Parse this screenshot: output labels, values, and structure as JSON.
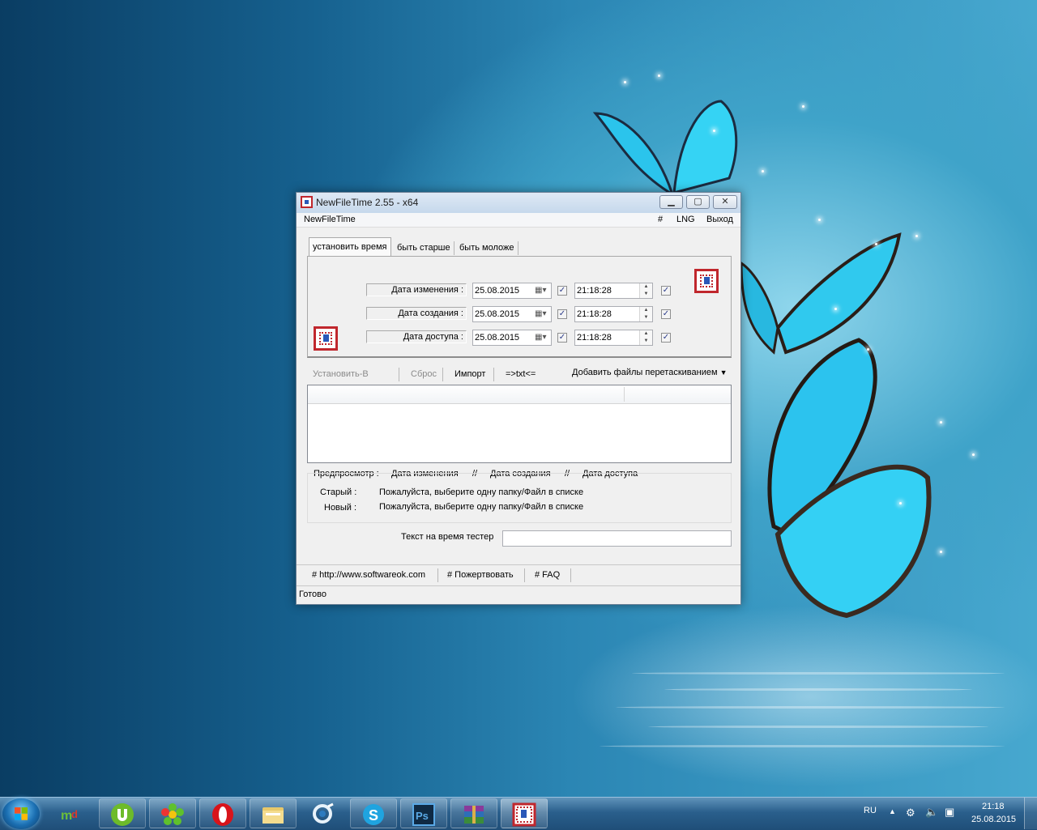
{
  "window": {
    "title": "NewFileTime 2.55 - x64",
    "minimize": "▁",
    "maximize": "▢",
    "close": "✕"
  },
  "menu": {
    "app": "NewFileTime",
    "hash": "#",
    "lng": "LNG",
    "exit": "Выход"
  },
  "tabs": [
    "установить время",
    "быть старше",
    "быть моложе"
  ],
  "rows": [
    {
      "label": "Дата изменения :",
      "date": "25.08.2015",
      "time": "21:18:28",
      "checked": true
    },
    {
      "label": "Дата создания :",
      "date": "25.08.2015",
      "time": "21:18:28",
      "checked": true
    },
    {
      "label": "Дата доступа :",
      "date": "25.08.2015",
      "time": "21:18:28",
      "checked": true
    }
  ],
  "toolbar": {
    "set": "Установить-В",
    "reset": "Сброс",
    "import": "Импорт",
    "txt": "=>txt<=",
    "dragdrop": "Добавить файлы перетаскиванием"
  },
  "preview": {
    "label": "Предпросмотр  :",
    "col1": "Дата изменения",
    "sep": "//",
    "col2": "Дата создания",
    "col3": "Дата доступа",
    "old_label": "Старый :",
    "old_value": "Пожалуйста, выберите одну папку/Файл в списке",
    "new_label": "Новый :",
    "new_value": "Пожалуйста, выберите одну папку/Файл в списке"
  },
  "tester": {
    "label": "Текст на время тестер",
    "value": ""
  },
  "links": {
    "website": "# http://www.softwareok.com",
    "donate": "# Пожертвовать",
    "faq": "# FAQ"
  },
  "status": "Готово",
  "taskbar": {
    "apps": [
      "mail-ru-agent",
      "utorrent",
      "icq",
      "opera",
      "file-explorer",
      "qip",
      "skype",
      "photoshop",
      "winrar",
      "newfiletime"
    ],
    "lang": "RU",
    "time": "21:18",
    "date": "25.08.2015"
  }
}
